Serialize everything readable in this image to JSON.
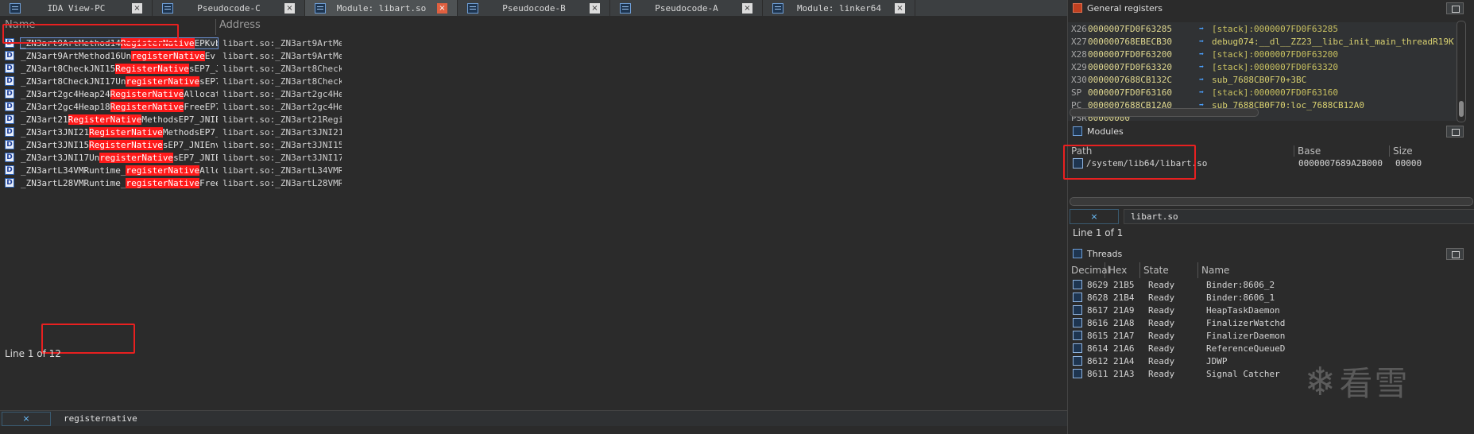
{
  "tabs": [
    {
      "label": "IDA View-PC",
      "active": false
    },
    {
      "label": "Pseudocode-C",
      "active": false
    },
    {
      "label": "Module: libart.so",
      "active": true
    },
    {
      "label": "Pseudocode-B",
      "active": false
    },
    {
      "label": "Pseudocode-A",
      "active": false
    },
    {
      "label": "Module: linker64",
      "active": false
    }
  ],
  "close_glyph": "×",
  "module_view": {
    "columns": {
      "name": "Name",
      "address": "Address"
    },
    "rows": [
      {
        "icon": "D",
        "pre": "_ZN3art9ArtMethod14",
        "hl": "RegisterNative",
        "post": "EPKvb",
        "address": "libart.so:_ZN3art9ArtMe…"
      },
      {
        "icon": "D",
        "pre": "_ZN3art9ArtMethod16Un",
        "hl": "registerNative",
        "post": "Ev",
        "address": "libart.so:_ZN3art9ArtMe…"
      },
      {
        "icon": "D",
        "pre": "_ZN3art8CheckJNI15",
        "hl": "RegisterNative",
        "post": "sEP7_J…",
        "address": "libart.so:_ZN3art8Check…"
      },
      {
        "icon": "D",
        "pre": "_ZN3art8CheckJNI17Un",
        "hl": "registerNative",
        "post": "sEP7…",
        "address": "libart.so:_ZN3art8Check…"
      },
      {
        "icon": "D",
        "pre": "_ZN3art2gc4Heap24",
        "hl": "RegisterNative",
        "post": "Allocat…",
        "address": "libart.so:_ZN3art2gc4He…"
      },
      {
        "icon": "D",
        "pre": "_ZN3art2gc4Heap18",
        "hl": "RegisterNative",
        "post": "FreeEP7…",
        "address": "libart.so:_ZN3art2gc4He…"
      },
      {
        "icon": "D",
        "pre": "_ZN3art21",
        "hl": "RegisterNative",
        "post": "MethodsEP7_JNIE…",
        "address": "libart.so:_ZN3art21Regi…"
      },
      {
        "icon": "D",
        "pre": "_ZN3art3JNI21",
        "hl": "RegisterNative",
        "post": "MethodsEP7_…",
        "address": "libart.so:_ZN3art3JNI21…"
      },
      {
        "icon": "D",
        "pre": "_ZN3art3JNI15",
        "hl": "RegisterNative",
        "post": "sEP7_JNIEnv…",
        "address": "libart.so:_ZN3art3JNI15…"
      },
      {
        "icon": "D",
        "pre": "_ZN3art3JNI17Un",
        "hl": "registerNative",
        "post": "sEP7_JNIE…",
        "address": "libart.so:_ZN3art3JNI17…"
      },
      {
        "icon": "D",
        "pre": "_ZN3artL34VMRuntime_",
        "hl": "registerNative",
        "post": "Allo…",
        "address": "libart.so:_ZN3artL34VMR…"
      },
      {
        "icon": "D",
        "pre": "_ZN3artL28VMRuntime_",
        "hl": "registerNative",
        "post": "Free…",
        "address": "libart.so:_ZN3artL28VMR…"
      }
    ],
    "search_text": "registernative",
    "status": "Line 1 of 12"
  },
  "general_registers": {
    "title": "General registers",
    "regs": [
      {
        "name": "X26",
        "value": "0000007FD0F63285",
        "desc": "[stack]:0000007FD0F63285",
        "label": false
      },
      {
        "name": "X27",
        "value": "000000768EBECB30",
        "desc": "debug074:__dl__ZZ23__libc_init_main_threadR19K",
        "label": true
      },
      {
        "name": "X28",
        "value": "0000007FD0F63200",
        "desc": "[stack]:0000007FD0F63200",
        "label": false
      },
      {
        "name": "X29",
        "value": "0000007FD0F63320",
        "desc": "[stack]:0000007FD0F63320",
        "label": false
      },
      {
        "name": "X30",
        "value": "0000007688CB132C",
        "desc": "sub_7688CB0F70+3BC",
        "label": true
      },
      {
        "name": "SP",
        "value": "0000007FD0F63160",
        "desc": "[stack]:0000007FD0F63160",
        "label": false
      },
      {
        "name": "PC",
        "value": "0000007688CB12A0",
        "desc": "sub_7688CB0F70:loc_7688CB12A0",
        "label": true
      },
      {
        "name": "PSR",
        "value": "60000000",
        "desc": "",
        "label": false
      }
    ]
  },
  "modules": {
    "title": "Modules",
    "columns": {
      "path": "Path",
      "base": "Base",
      "size": "Size"
    },
    "rows": [
      {
        "path": "/system/lib64/libart.so",
        "base": "0000007689A2B000",
        "size": "00000"
      }
    ],
    "filter_text": "libart.so",
    "status": "Line 1 of 1"
  },
  "threads": {
    "title": "Threads",
    "columns": {
      "decimal": "Decimal",
      "hex": "Hex",
      "state": "State",
      "name": "Name"
    },
    "rows": [
      {
        "decimal": "8629",
        "hex": "21B5",
        "state": "Ready",
        "name": "Binder:8606_2"
      },
      {
        "decimal": "8628",
        "hex": "21B4",
        "state": "Ready",
        "name": "Binder:8606_1"
      },
      {
        "decimal": "8617",
        "hex": "21A9",
        "state": "Ready",
        "name": "HeapTaskDaemon"
      },
      {
        "decimal": "8616",
        "hex": "21A8",
        "state": "Ready",
        "name": "FinalizerWatchd"
      },
      {
        "decimal": "8615",
        "hex": "21A7",
        "state": "Ready",
        "name": "FinalizerDaemon"
      },
      {
        "decimal": "8614",
        "hex": "21A6",
        "state": "Ready",
        "name": "ReferenceQueueD"
      },
      {
        "decimal": "8612",
        "hex": "21A4",
        "state": "Ready",
        "name": "JDWP"
      },
      {
        "decimal": "8611",
        "hex": "21A3",
        "state": "Ready",
        "name": "Signal Catcher"
      }
    ]
  },
  "watermark": {
    "glyph": "❄",
    "text": "看雪"
  },
  "colors": {
    "highlight": "#ff1a1a",
    "annotation_box": "#e82020",
    "background": "#2b2b2b"
  }
}
